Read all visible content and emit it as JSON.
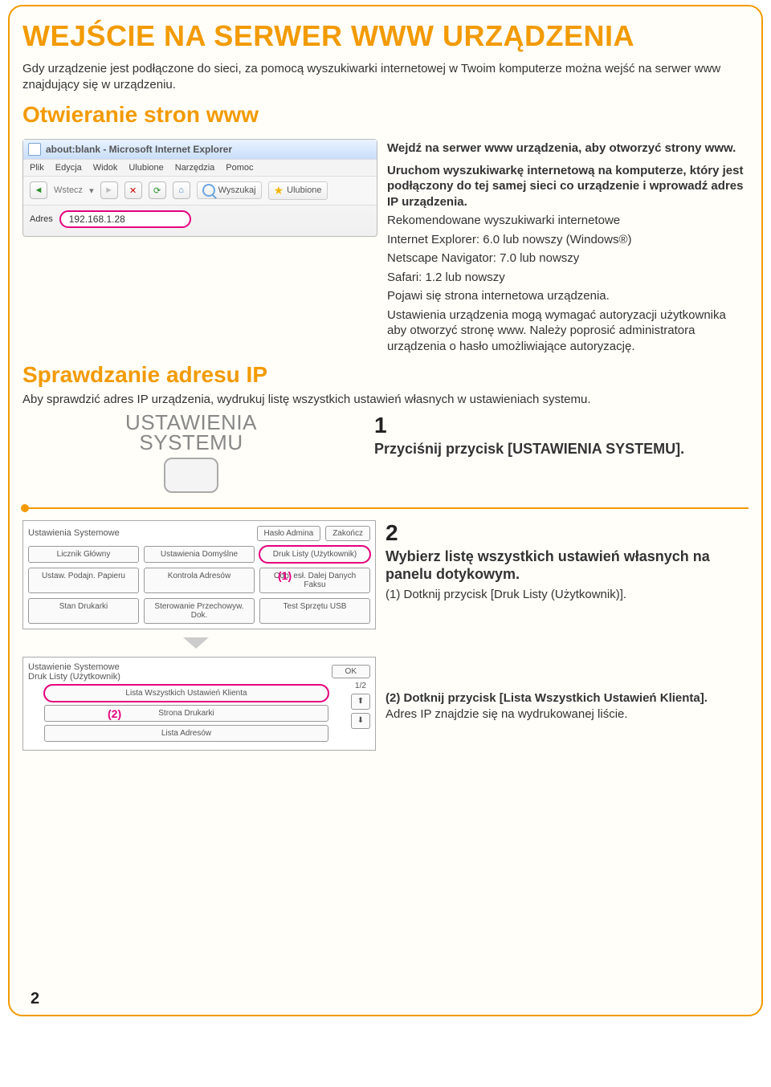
{
  "title": "WEJŚCIE NA SERWER WWW URZĄDZENIA",
  "intro": "Gdy urządzenie jest podłączone do sieci, za pomocą wyszukiwarki internetowej w Twoim komputerze można wejść na serwer www znajdujący się w urządzeniu.",
  "h2_open": "Otwieranie stron www",
  "browser": {
    "titlebar": "about:blank - Microsoft Internet Explorer",
    "menu": [
      "Plik",
      "Edycja",
      "Widok",
      "Ulubione",
      "Narzędzia",
      "Pomoc"
    ],
    "back_label": "Wstecz",
    "search_label": "Wyszukaj",
    "fav_label": "Ulubione",
    "addr_label": "Adres",
    "addr_value": "192.168.1.28"
  },
  "instr_head": "Wejdź na serwer www urządzenia, aby otworzyć strony www.",
  "instr_sub1": "Uruchom wyszukiwarkę internetową na komputerze, który jest podłączony do tej samej sieci co urządzenie i wprowadź adres IP urządzenia.",
  "instr_body1a": "Rekomendowane wyszukiwarki internetowe",
  "instr_body1b": "Internet Explorer: 6.0 lub nowszy (Windows®)",
  "instr_body1c": "Netscape Navigator: 7.0 lub nowszy",
  "instr_body1d": "Safari: 1.2 lub nowszy",
  "instr_body1e": "Pojawi się strona internetowa urządzenia.",
  "instr_body1f": "Ustawienia urządzenia mogą wymagać autoryzacji użytkownika aby otworzyć stronę www. Należy poprosić administratora urządzenia o hasło umożliwiające autoryzację.",
  "h2_check": "Sprawdzanie adresu IP",
  "check_intro": "Aby sprawdzić adres IP urządzenia, wydrukuj listę wszystkich ustawień własnych w ustawieniach systemu.",
  "sys_label1": "USTAWIENIA",
  "sys_label2": "SYSTEMU",
  "step1_num": "1",
  "step1_head": "Przyciśnij przycisk [USTAWIENIA SYSTEMU].",
  "panel1": {
    "title": "Ustawienia Systemowe",
    "admin_btn": "Hasło Admina",
    "close_btn": "Zakończ",
    "cells": [
      "Licznik Główny",
      "Ustawienia Domyślne",
      "Druk Listy (Użytkownik)",
      "Ustaw. Podajn. Papieru",
      "Kontrola Adresów",
      "Odb. esł. Dalej Danych Faksu",
      "Stan Drukarki",
      "Sterowanie Przechowyw. Dok.",
      "Test Sprzętu USB"
    ],
    "marker": "(1)"
  },
  "step2_num": "2",
  "step2_head": "Wybierz listę wszystkich ustawień własnych na panelu dotykowym.",
  "step2_sub": "(1)  Dotknij przycisk [Druk Listy (Użytkownik)].",
  "panel2": {
    "title": "Ustawienie Systemowe",
    "subtitle": "Druk Listy (Użytkownik)",
    "ok": "OK",
    "items": [
      "Lista Wszystkich Ustawień Klienta",
      "Strona          Drukarki",
      "Lista Adresów"
    ],
    "marker": "(2)",
    "page": "1/2"
  },
  "step3_head": "(2)  Dotknij przycisk [Lista Wszystkich Ustawień Klienta].",
  "step3_sub": "Adres IP znajdzie się na wydrukowanej liście.",
  "page_num": "2"
}
